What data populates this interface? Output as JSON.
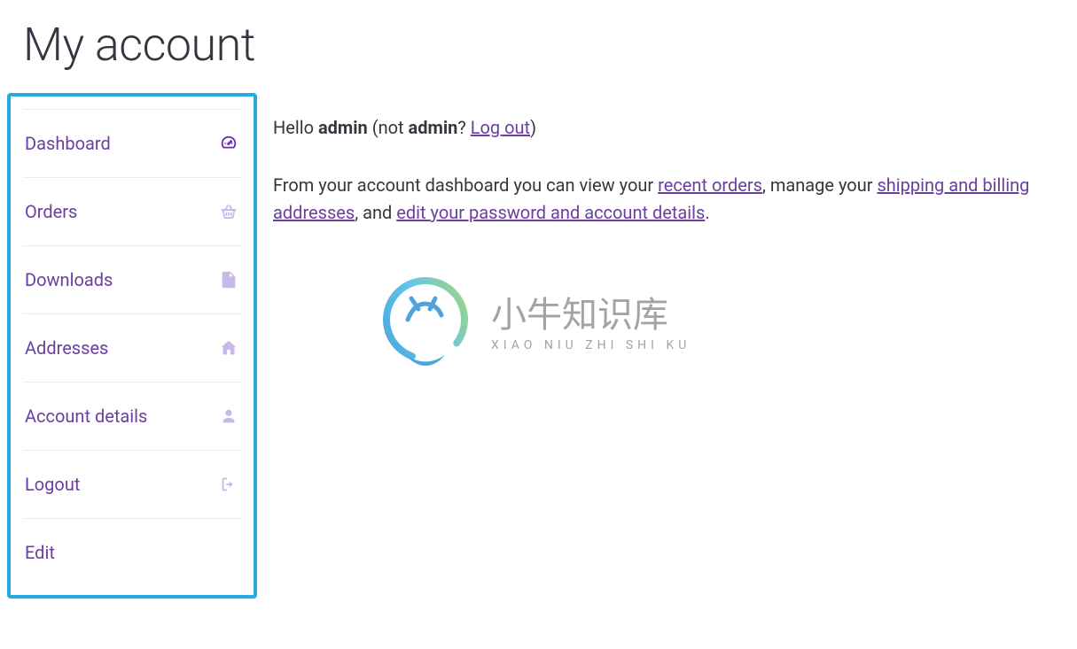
{
  "page": {
    "title": "My account"
  },
  "sidebar": {
    "items": [
      {
        "label": "Dashboard",
        "active": true
      },
      {
        "label": "Orders"
      },
      {
        "label": "Downloads"
      },
      {
        "label": "Addresses"
      },
      {
        "label": "Account details"
      },
      {
        "label": "Logout"
      },
      {
        "label": "Edit"
      }
    ]
  },
  "content": {
    "hello_prefix": "Hello ",
    "username": "admin",
    "not_prefix": " (not ",
    "not_username": "admin",
    "question": "? ",
    "logout_link": "Log out",
    "close_paren": ")",
    "body_1": "From your account dashboard you can view your ",
    "link_recent_orders": "recent orders",
    "body_2": ", manage your ",
    "link_shipping_billing": "shipping and billing addresses",
    "body_3": ", and ",
    "link_edit_account": "edit your password and account details",
    "body_4": "."
  },
  "watermark": {
    "cn": "小牛知识库",
    "en": "XIAO NIU ZHI SHI KU"
  }
}
